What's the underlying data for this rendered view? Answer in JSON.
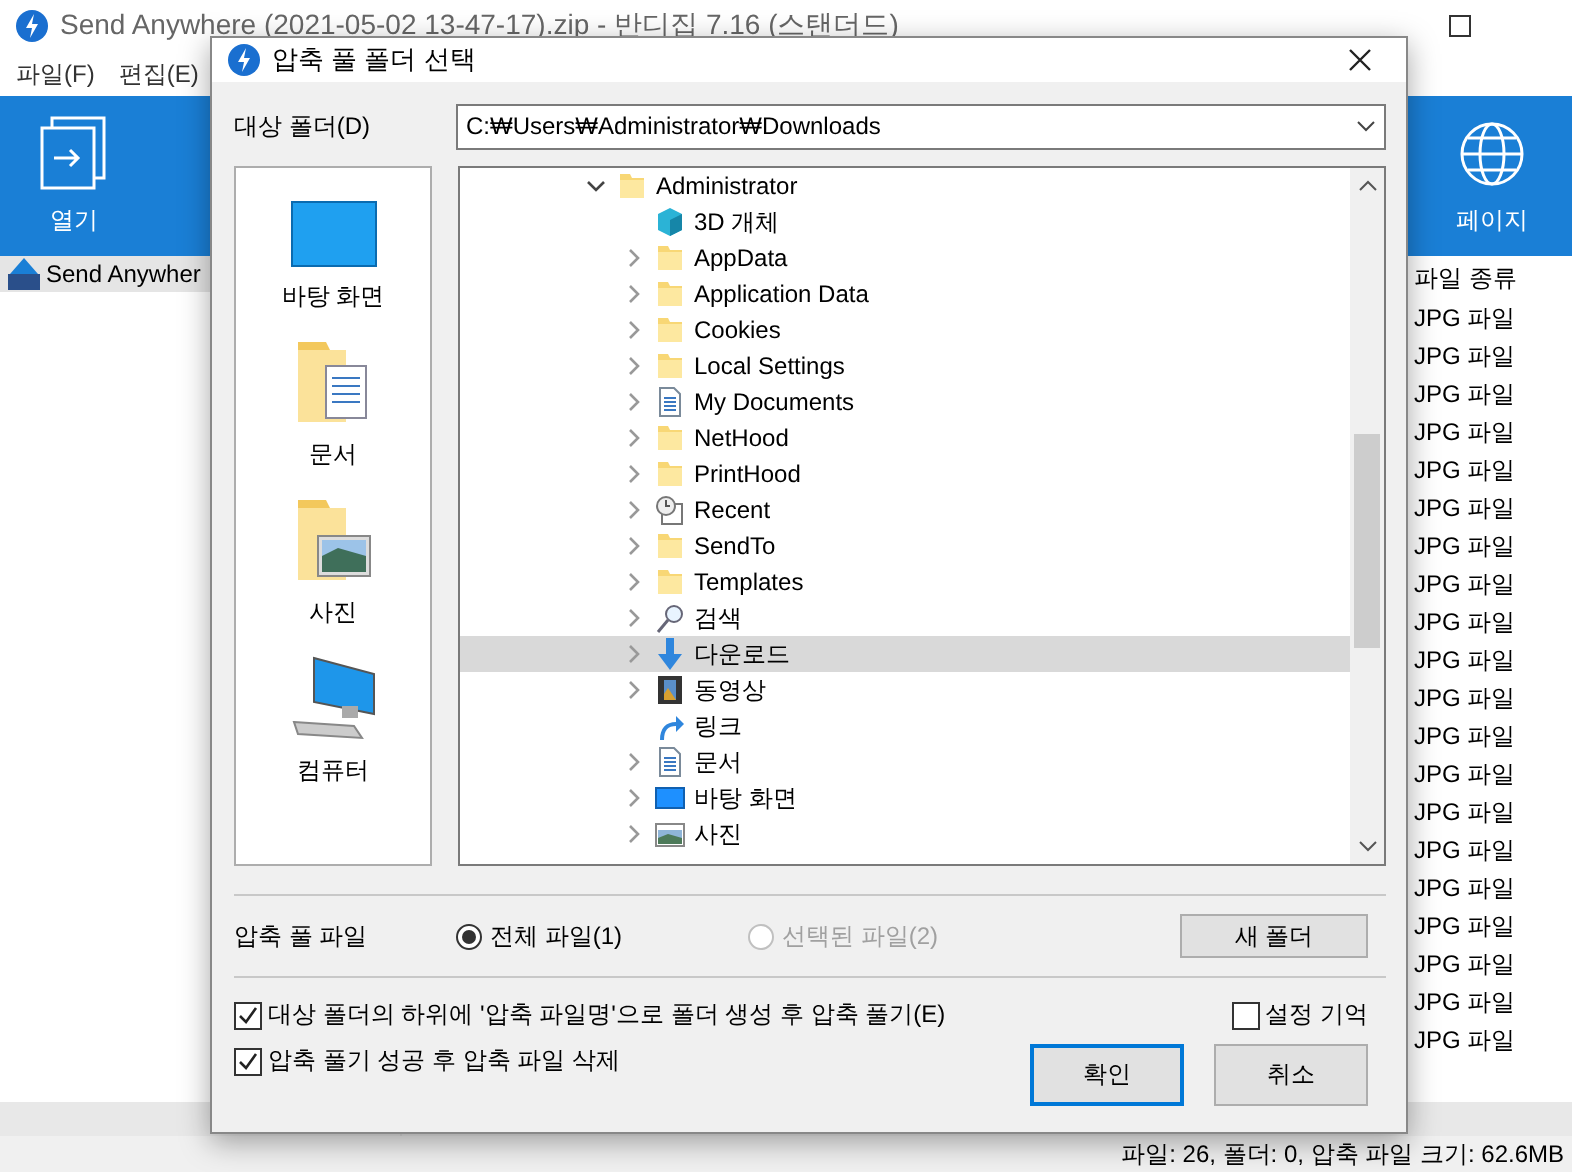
{
  "app": {
    "title": "Send Anywhere (2021-05-02 13-47-17).zip - 반디집 7.16 (스탠더드)",
    "menu": [
      "파일(F)",
      "편집(E)"
    ],
    "toolbar": [
      {
        "label": "열기",
        "kind": "open"
      },
      {
        "label": "페이지",
        "kind": "web"
      }
    ],
    "tree": [
      {
        "label": "Send Anywher",
        "selected": true
      }
    ],
    "file_list": {
      "columns": [
        "파일 종류"
      ],
      "rows": [
        "JPG 파일",
        "JPG 파일",
        "JPG 파일",
        "JPG 파일",
        "JPG 파일",
        "JPG 파일",
        "JPG 파일",
        "JPG 파일",
        "JPG 파일",
        "JPG 파일",
        "JPG 파일",
        "JPG 파일",
        "JPG 파일",
        "JPG 파일",
        "JPG 파일",
        "JPG 파일",
        "JPG 파일",
        "JPG 파일",
        "JPG 파일",
        "JPG 파일"
      ]
    },
    "status_bar": "파일: 26, 폴더: 0, 압축 파일 크기: 62.6MB"
  },
  "dialog": {
    "title": "압축 풀 폴더 선택",
    "target_label": "대상 폴더(D)",
    "target_value": "C:₩Users₩Administrator₩Downloads",
    "places": [
      {
        "label": "바탕 화면",
        "kind": "desktop"
      },
      {
        "label": "문서",
        "kind": "documents"
      },
      {
        "label": "사진",
        "kind": "pictures"
      },
      {
        "label": "컴퓨터",
        "kind": "computer"
      }
    ],
    "tree": [
      {
        "label": "Administrator",
        "kind": "folder",
        "expanded": true,
        "selected": false,
        "children": [
          {
            "label": "3D 개체",
            "kind": "cube",
            "expandable": false,
            "selected": false
          },
          {
            "label": "AppData",
            "kind": "folder",
            "expandable": true,
            "selected": false
          },
          {
            "label": "Application Data",
            "kind": "folder",
            "expandable": true,
            "selected": false
          },
          {
            "label": "Cookies",
            "kind": "folder",
            "expandable": true,
            "selected": false
          },
          {
            "label": "Local Settings",
            "kind": "folder",
            "expandable": true,
            "selected": false
          },
          {
            "label": "My Documents",
            "kind": "document",
            "expandable": true,
            "selected": false
          },
          {
            "label": "NetHood",
            "kind": "folder",
            "expandable": true,
            "selected": false
          },
          {
            "label": "PrintHood",
            "kind": "folder",
            "expandable": true,
            "selected": false
          },
          {
            "label": "Recent",
            "kind": "recent",
            "expandable": true,
            "selected": false
          },
          {
            "label": "SendTo",
            "kind": "folder",
            "expandable": true,
            "selected": false
          },
          {
            "label": "Templates",
            "kind": "folder",
            "expandable": true,
            "selected": false
          },
          {
            "label": "검색",
            "kind": "search",
            "expandable": true,
            "selected": false
          },
          {
            "label": "다운로드",
            "kind": "download",
            "expandable": true,
            "selected": true
          },
          {
            "label": "동영상",
            "kind": "video",
            "expandable": true,
            "selected": false
          },
          {
            "label": "링크",
            "kind": "shortcut",
            "expandable": false,
            "selected": false
          },
          {
            "label": "문서",
            "kind": "document",
            "expandable": true,
            "selected": false
          },
          {
            "label": "바탕 화면",
            "kind": "desktop",
            "expandable": true,
            "selected": false
          },
          {
            "label": "사진",
            "kind": "picture",
            "expandable": true,
            "selected": false
          }
        ]
      }
    ],
    "extract_label": "압축 풀 파일",
    "extract_options": [
      {
        "label": "전체 파일(1)",
        "selected": true,
        "disabled": false
      },
      {
        "label": "선택된 파일(2)",
        "selected": false,
        "disabled": true
      }
    ],
    "new_folder": "새 폴더",
    "checkboxes": [
      {
        "label": "대상 폴더의 하위에 '압축 파일명'으로 폴더 생성 후 압축 풀기(E)",
        "checked": true
      },
      {
        "label": "압축 풀기 성공 후 압축 파일 삭제",
        "checked": true
      }
    ],
    "remember": {
      "label": "설정 기억",
      "checked": false
    },
    "buttons": [
      {
        "label": "확인",
        "default": true
      },
      {
        "label": "취소",
        "default": false
      }
    ]
  }
}
